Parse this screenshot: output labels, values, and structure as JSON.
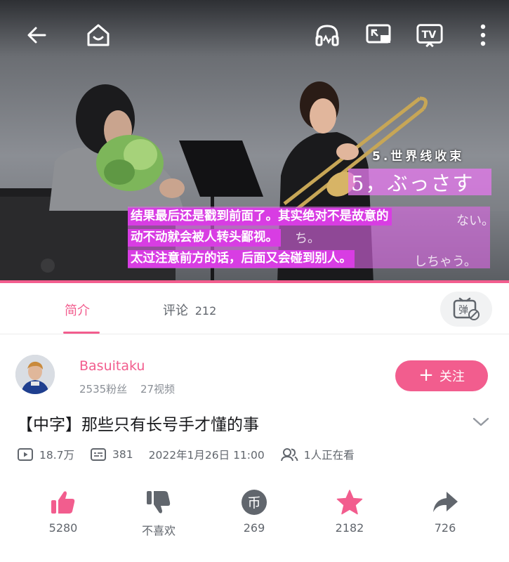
{
  "video": {
    "subtitle_title": "5.世界线收束",
    "jp_band": "5，ぶっさす",
    "jp_faint_1": "ない。",
    "jp_faint_2": "ち。",
    "jp_faint_3": "しちゃう。",
    "subtitle_lines": [
      "结果最后还是戳到前面了。其实绝对不是故意的",
      "动不动就会被人转头鄙视。",
      "太过注意前方的话，后面又会碰到别人。"
    ],
    "topbar_icons": [
      "back-arrow-icon",
      "home-icon",
      "headphones-icon",
      "cast-icon",
      "tv-icon",
      "more-icon"
    ],
    "progress_color": "#f25d8e"
  },
  "tabs": {
    "intro": "简介",
    "comments": "评论",
    "comments_count": "212",
    "danmaku_icon_char": "弹"
  },
  "uploader": {
    "name": "Basuitaku",
    "fans": "2535粉丝",
    "videos": "27视频",
    "follow_label": "关注",
    "follow_plus": "+"
  },
  "title": "【中字】那些只有长号手才懂的事",
  "meta": {
    "views": "18.7万",
    "danmaku": "381",
    "date": "2022年1月26日 11:00",
    "watching": "1人正在看"
  },
  "actions": {
    "like": "5280",
    "dislike": "不喜欢",
    "coin": "269",
    "coin_char": "币",
    "favorite": "2182",
    "share": "726"
  },
  "colors": {
    "accent": "#f25d8e",
    "icon_grey": "#61666d",
    "subtitle_bg": "#d83de3"
  }
}
